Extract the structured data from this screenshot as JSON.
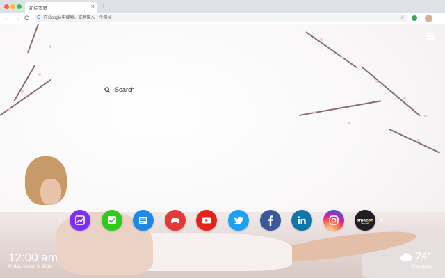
{
  "browser": {
    "tab_title": "新标签页",
    "tab_close": "×",
    "new_tab": "+",
    "back": "←",
    "forward": "→",
    "reload": "C",
    "omnibox_logo": "G",
    "omnibox_placeholder": "在Google中搜索，或者输入一个网址",
    "star": "☆",
    "menu": "⋮"
  },
  "search": {
    "placeholder": "Search"
  },
  "shortcuts": [
    {
      "name": "photo-app",
      "icon": "photo-icon",
      "color": "#7b2ff7"
    },
    {
      "name": "tasks-app",
      "icon": "check-icon",
      "color": "#2ecc1a"
    },
    {
      "name": "news-app",
      "icon": "news-icon",
      "color": "#1e88e5"
    },
    {
      "name": "games-app",
      "icon": "gamepad-icon",
      "color": "#e53935"
    },
    {
      "name": "youtube",
      "icon": "youtube-icon",
      "color": "#e62117"
    },
    {
      "name": "twitter",
      "icon": "twitter-icon",
      "color": "#1da1f2"
    },
    {
      "name": "facebook",
      "icon": "facebook-icon",
      "color": "#3b5998"
    },
    {
      "name": "linkedin",
      "icon": "linkedin-icon",
      "color": "#0e76a8"
    },
    {
      "name": "instagram",
      "icon": "instagram-icon",
      "color": "#d6249f"
    },
    {
      "name": "amazon",
      "icon": "amazon-icon",
      "color": "#1f1f1f",
      "label": "amazon"
    }
  ],
  "nav": {
    "prev": "‹",
    "next": "›"
  },
  "clock": {
    "time": "12:00 am",
    "date": "Friday, March 9, 2018"
  },
  "weather": {
    "temp": "24°",
    "city": "Chongqing",
    "icon": "cloud-icon"
  }
}
